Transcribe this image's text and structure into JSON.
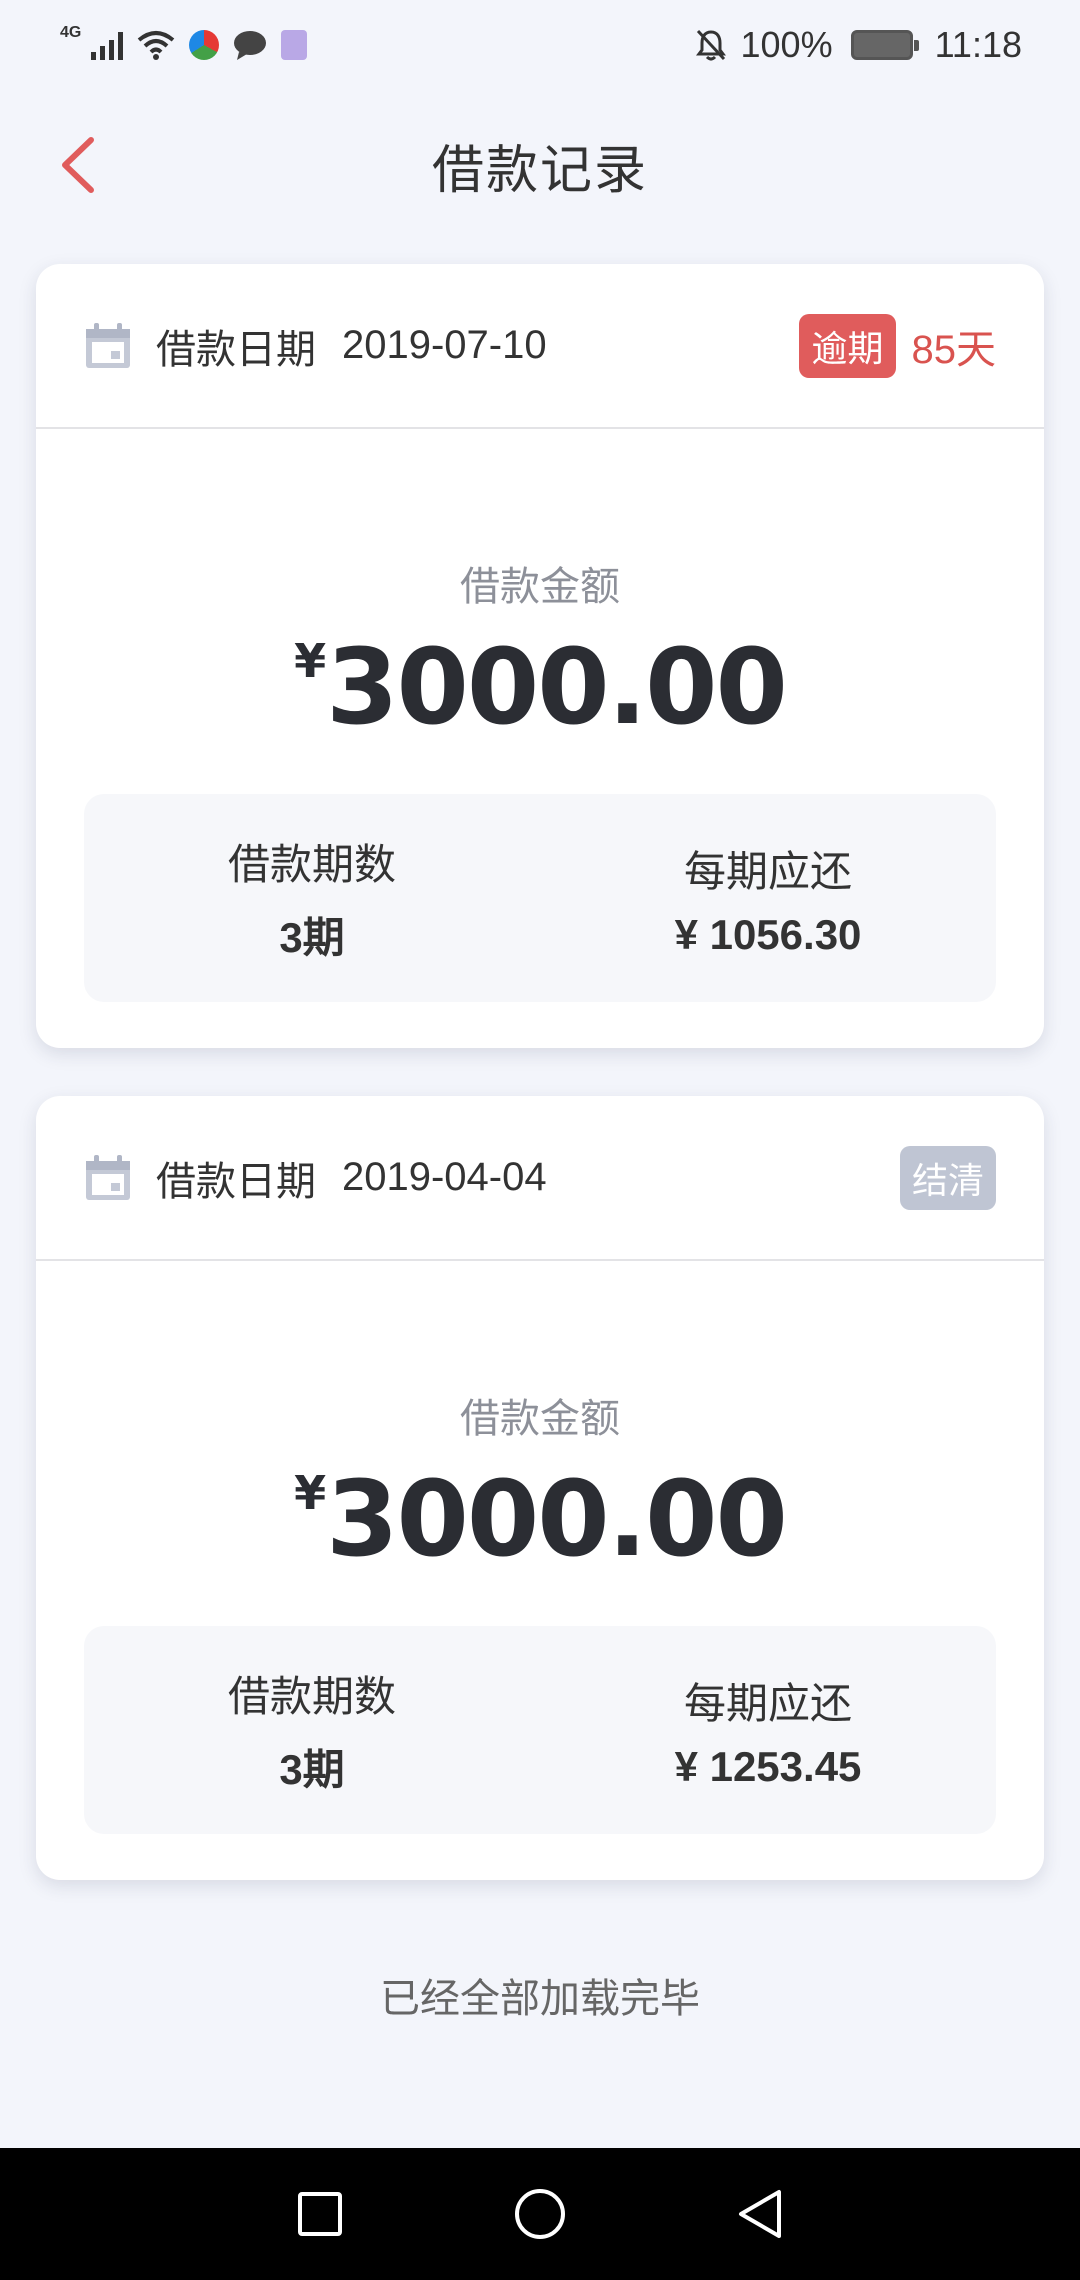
{
  "status_bar": {
    "network": "4G",
    "battery": "100%",
    "time": "11:18",
    "icons": [
      "signal-icon",
      "wifi-icon",
      "app-icon",
      "message-icon",
      "notes-icon",
      "mute-bell-icon",
      "battery-icon"
    ]
  },
  "header": {
    "title": "借款记录",
    "back_icon": "chevron-left-icon",
    "accent_color": "#e05c5c"
  },
  "records": [
    {
      "date_label": "借款日期",
      "date": "2019-07-10",
      "status": "逾期",
      "status_color": "#e05c5c",
      "overdue_days": "85天",
      "amount_label": "借款金额",
      "currency": "¥",
      "amount": "3000.00",
      "periods_label": "借款期数",
      "periods": "3期",
      "per_period_label": "每期应还",
      "per_period": "¥ 1056.30"
    },
    {
      "date_label": "借款日期",
      "date": "2019-04-04",
      "status": "结清",
      "status_color": "#bfc5d3",
      "amount_label": "借款金额",
      "currency": "¥",
      "amount": "3000.00",
      "periods_label": "借款期数",
      "periods": "3期",
      "per_period_label": "每期应还",
      "per_period": "¥ 1253.45"
    }
  ],
  "footer": {
    "all_loaded": "已经全部加载完毕"
  },
  "nav_bar": {
    "icons": [
      "recents-square-icon",
      "home-circle-icon",
      "back-triangle-icon"
    ]
  }
}
